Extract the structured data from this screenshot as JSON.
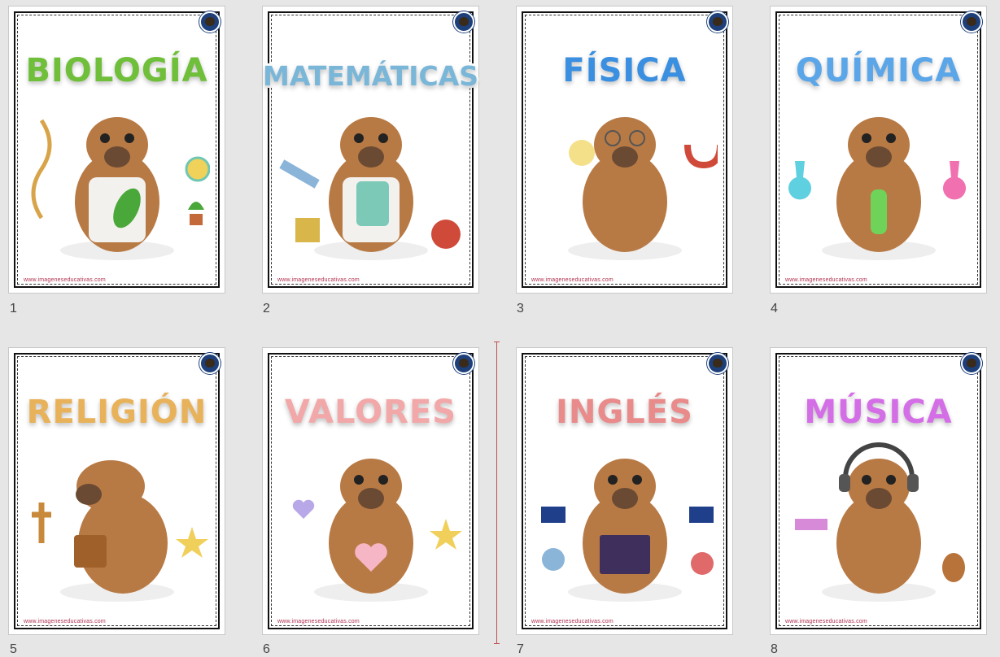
{
  "slides": [
    {
      "number": "1",
      "title": "BIOLOGÍA",
      "title_color": "#6fbf3a",
      "website": "www.imageneseducativas.com"
    },
    {
      "number": "2",
      "title": "MATEMÁTICAS",
      "title_color": "#79b6d8",
      "website": "www.imageneseducativas.com"
    },
    {
      "number": "3",
      "title": "FÍSICA",
      "title_color": "#3a8fe0",
      "website": "www.imageneseducativas.com"
    },
    {
      "number": "4",
      "title": "QUÍMICA",
      "title_color": "#5aa6e8",
      "website": "www.imageneseducativas.com"
    },
    {
      "number": "5",
      "title": "RELIGIÓN",
      "title_color": "#e8b25a",
      "website": "www.imageneseducativas.com"
    },
    {
      "number": "6",
      "title": "VALORES",
      "title_color": "#f2a8a8",
      "website": "www.imageneseducativas.com"
    },
    {
      "number": "7",
      "title": "INGLÉS",
      "title_color": "#e98b8b",
      "website": "www.imageneseducativas.com"
    },
    {
      "number": "8",
      "title": "MÚSICA",
      "title_color": "#d46ee6",
      "website": "www.imageneseducativas.com"
    }
  ],
  "theme": {
    "background": "#e6e6e6",
    "drop_marker_color": "#c0504d",
    "capybara_color": "#b87a45"
  },
  "icons": {
    "slide_badge": "mascot-badge-icon",
    "illustration": "capybara-illustration"
  }
}
